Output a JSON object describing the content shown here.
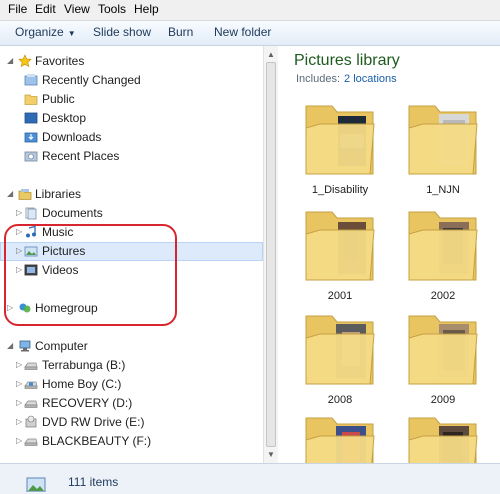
{
  "menu": [
    "File",
    "Edit",
    "View",
    "Tools",
    "Help"
  ],
  "toolbar": {
    "organize": "Organize",
    "slideshow": "Slide show",
    "burn": "Burn",
    "new_folder": "New folder"
  },
  "nav": {
    "favorites": "Favorites",
    "fav_items": [
      "Recently Changed",
      "Public",
      "Desktop",
      "Downloads",
      "Recent Places"
    ],
    "libraries": "Libraries",
    "lib_items": [
      "Documents",
      "Music",
      "Pictures",
      "Videos"
    ],
    "homegroup": "Homegroup",
    "computer": "Computer",
    "drives": [
      "Terrabunga (B:)",
      "Home Boy (C:)",
      "RECOVERY (D:)",
      "DVD RW Drive (E:)",
      "BLACKBEAUTY (F:)"
    ]
  },
  "library": {
    "title": "Pictures library",
    "includes_label": "Includes:",
    "locations": "2 locations"
  },
  "folders": [
    "1_Disability",
    "1_NJN",
    "2001",
    "2002",
    "2008",
    "2009",
    "",
    ""
  ],
  "status": {
    "items": "111 items"
  }
}
